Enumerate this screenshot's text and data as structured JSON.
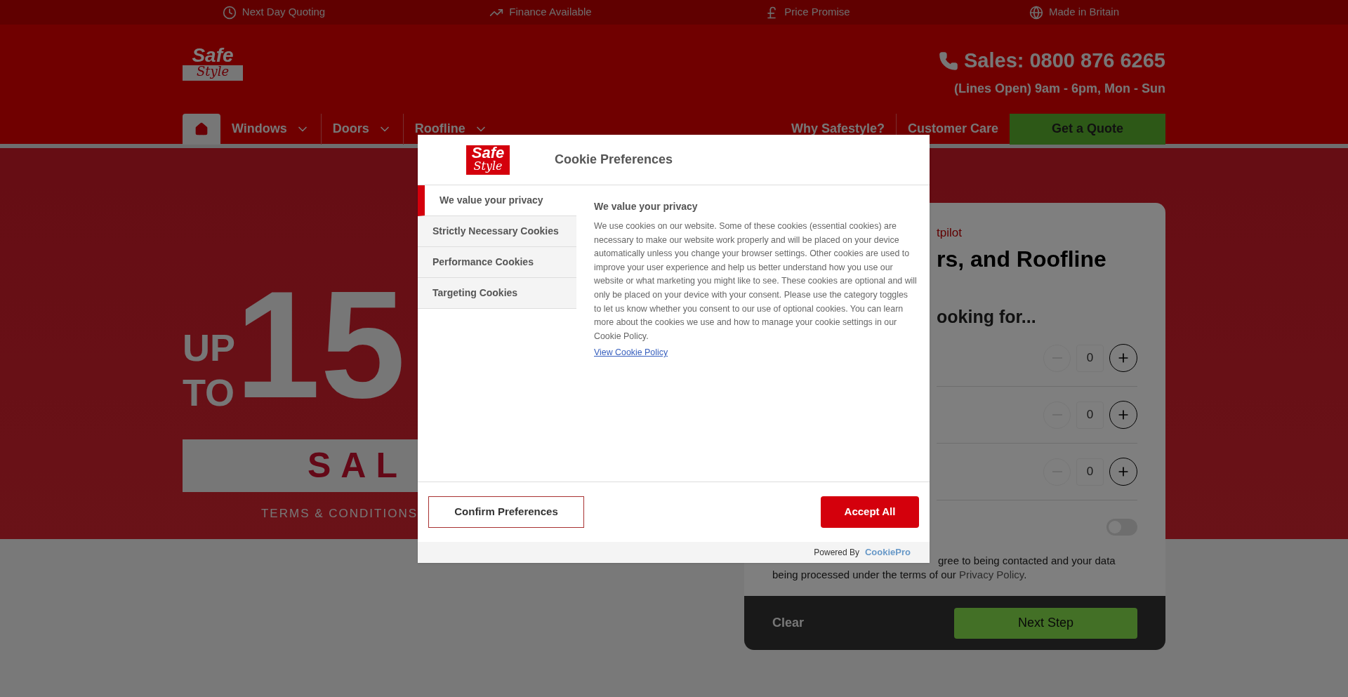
{
  "top_bar": [
    {
      "label": "Next Day Quoting"
    },
    {
      "label": "Finance Available"
    },
    {
      "label": "Price Promise"
    },
    {
      "label": "Made in Britain"
    }
  ],
  "header": {
    "logo_top": "Safe",
    "logo_bottom": "Style",
    "phone": "Sales: 0800 876 6265",
    "hours": "(Lines Open) 9am - 6pm, Mon - Sun"
  },
  "nav": {
    "items": [
      {
        "label": "Windows",
        "dropdown": true
      },
      {
        "label": "Doors",
        "dropdown": true
      },
      {
        "label": "Roofline",
        "dropdown": true
      }
    ],
    "links": [
      "Why Safestyle?",
      "Customer Care"
    ],
    "quote_button": "Get a Quote"
  },
  "hero": {
    "up": "UP",
    "to": "TO",
    "number": "15",
    "sale": "SAL",
    "terms": "TERMS & CONDITIONS"
  },
  "quote_form": {
    "rating_text": "tpilot",
    "heading": "rs, and Roofline",
    "subheading": "ooking for...",
    "counters": [
      {
        "value": "0"
      },
      {
        "value": "0"
      },
      {
        "value": "0"
      }
    ],
    "toggle": {
      "on": false
    },
    "consent": "gree to being contacted and your data being processed under the terms of our ",
    "consent_link": "Privacy Policy",
    "consent_end": ".",
    "clear": "Clear",
    "next": "Next Step"
  },
  "cookie_modal": {
    "logo_top": "Safe",
    "logo_bottom": "Style",
    "title": "Cookie Preferences",
    "tabs": [
      {
        "label": "We value your privacy",
        "selected": true
      },
      {
        "label": "Strictly Necessary Cookies",
        "selected": false
      },
      {
        "label": "Performance Cookies",
        "selected": false
      },
      {
        "label": "Targeting Cookies",
        "selected": false
      }
    ],
    "heading": "We value your privacy",
    "body": "We use cookies on our website. Some of these cookies (essential cookies) are necessary to make our website work properly and will be placed on your device automatically unless you change your browser settings. Other cookies are used to improve your user experience and help us better understand how you use our website or what marketing you might like to see. These cookies are optional and will only be placed on your device with your consent. Please use the category toggles to let us know whether you consent to our use of optional cookies. You can learn more about the cookies we use and how to manage your cookie settings in our Cookie Policy.",
    "policy_link": "View Cookie Policy",
    "confirm_button": "Confirm Preferences",
    "accept_button": "Accept All",
    "powered_by": "Powered By",
    "brand": "CookiePro"
  }
}
